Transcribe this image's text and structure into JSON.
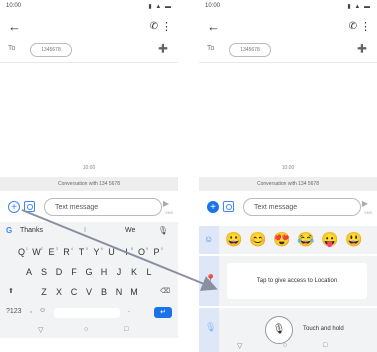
{
  "status": {
    "time": "10:00",
    "system": "▮ ▲ ▬"
  },
  "icons": {
    "back": "←",
    "call": "✆",
    "more": "⋮",
    "add_contact": "➕",
    "plus": "+",
    "send": "▶",
    "mic": "🎙",
    "shift": "⬆",
    "backspace": "⌫",
    "emoji": "☺",
    "enter": "↵",
    "location": "📍",
    "voice": "🎙",
    "nav_back": "▽",
    "nav_home": "○",
    "nav_recent": "□"
  },
  "header": {
    "to_label": "To",
    "recipient_chip": "1345678"
  },
  "thread": {
    "timestamp": "10:00",
    "conversation_label": "Conversation with 134 5678"
  },
  "compose": {
    "placeholder": "Text message",
    "send_sub": "SMS"
  },
  "keyboard": {
    "suggestions": [
      "Thanks",
      "I",
      "We"
    ],
    "row1": [
      "Q",
      "W",
      "E",
      "R",
      "T",
      "Y",
      "U",
      "I",
      "O",
      "P"
    ],
    "row1_hints": [
      "1",
      "2",
      "3",
      "4",
      "5",
      "6",
      "7",
      "8",
      "9",
      "0"
    ],
    "row2": [
      "A",
      "S",
      "D",
      "F",
      "G",
      "H",
      "J",
      "K",
      "L"
    ],
    "row3": [
      "Z",
      "X",
      "C",
      "V",
      "B",
      "N",
      "M"
    ],
    "sym_label": "?123",
    "comma": ",",
    "period": "."
  },
  "emoji_strip": [
    "😀",
    "😊",
    "😍",
    "😂",
    "😛",
    "😃"
  ],
  "location_panel": {
    "text": "Tap to give access to Location"
  },
  "voice_panel": {
    "text": "Touch and hold"
  },
  "colors": {
    "accent": "#1a73e8",
    "panel_tab": "#dde7f8",
    "keyboard_bg": "#f1f3f4",
    "arrow": "#8a8fa0"
  }
}
